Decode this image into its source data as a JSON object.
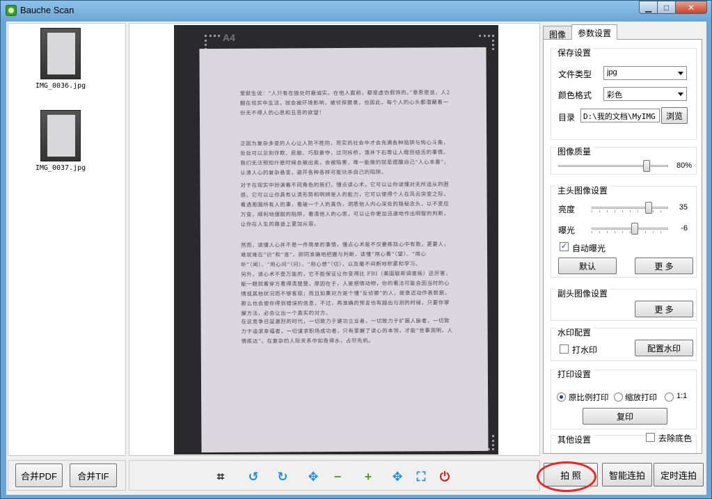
{
  "window": {
    "title": "Bauche Scan",
    "controls": {
      "minimize": "▁",
      "maximize": "□",
      "close": "✕"
    }
  },
  "thumbnails": [
    {
      "name": "IMG_0036.jpg"
    },
    {
      "name": "IMG_0037.jpg"
    }
  ],
  "preview": {
    "paper_size": "A4",
    "paragraphs": [
      "爱默生说：“人只有在独处时最诚实。在他人面前，都是虚伪假饰的。”意思是说，人2 翻在现实中生活，就会被环境影响，被侦探摄录，也因此，每个人的心头都潜藏着一份无不得人的心思和丑恶的欲望！",
      "正因为复杂多变的人心让人防不胜防，现实的社会中才会充满各种陷阱与钩心斗角，处处可以见到诈欺、民脑、巧取豪夺，过河拆桥，落井下石等让人瞠目结舌的事情。我们无法预知什麽时候会被出卖，会被陷害，唯一能做的就是提醒自己“人心本善”，认清人心的复杂悬变，避开各种各样可能坑杀自己的陷阱。",
      "对于在现实中扮演着不同角色的我们，懂点读心术，它可以让你读懂对无所适从的困惑，它可以让你具有认清形势和明辨是人的能力，它可以使得个人在风云突变之际，看透周围所有人的事，看破一个人的真伪，洞悉他人内心深处的隐秘念头，以不变应万变，顺利地摆脱的陷阱，看清他人的心思，可以让你更加迅速地作出明智的判断，让你在人生的路途上更加从容。",
      "然而，读懂人心并不是一件简单的事情，懂点心术是不仅要练就心中有数，更要人，难就难在“识”和“准”，即同准确地把握与判断，读懂“用心看”（望）、“用心听”（闻）、“用心问”（问）、“用心想”（切），以及毫不间断地积累和学习。",
      "另外，读心术不是万能的，它不能保证让你变得比 FBI（美国联邦调查局）还厉害，能一眼就看穿方看得清楚楚，原因在于，人是感情动物，你的看法可能会因当时的心情或其他状况而不够客观；而且如果对方是个懂“反侦察”的人，故意迟动作表数据，那么也会使你得到错误的信息，不过，再准确的预言也有超出与测的时候，只要你掌握方法，必会让出一个真实的对方。",
      "在这竞争日益激烈的时代，一切致力于建功立业者，一切致力于扩展人脉者，一切致力于追求幸福者，一切谋求职场成功者，只有掌握了读心的本领，才能“世事洞明，人情练达”，在复杂的人际关系中如鱼得水，占尽先机。"
    ]
  },
  "settings": {
    "tabs": [
      {
        "label": "图像"
      },
      {
        "label": "参数设置"
      }
    ],
    "save": {
      "title": "保存设置",
      "file_type_label": "文件类型",
      "file_type_value": "jpg",
      "color_format_label": "颜色格式",
      "color_format_value": "彩色",
      "directory_label": "目录",
      "directory_value": "D:\\我的文档\\MyIMG",
      "browse_label": "浏览"
    },
    "quality": {
      "title": "图像质量",
      "value": "80%",
      "level": 0.8
    },
    "main_camera": {
      "title": "主头图像设置",
      "brightness_label": "亮度",
      "brightness_value": "35",
      "exposure_label": "曝光",
      "exposure_value": "-6",
      "auto_exposure_label": "自动曝光",
      "auto_exposure_checked": true,
      "default_label": "默认",
      "more_label": "更 多"
    },
    "sub_camera": {
      "title": "副头图像设置",
      "more_label": "更 多"
    },
    "watermark": {
      "title": "水印配置",
      "enable_label": "打水印",
      "configure_label": "配置水印"
    },
    "print": {
      "title": "打印设置",
      "option_original": "原比例打印",
      "option_scaled": "缩放打印",
      "option_1to1": "1:1",
      "selected": "原比例打印",
      "copy_label": "复印"
    },
    "other": {
      "title": "其他设置",
      "remove_bg_label": "去除底色"
    }
  },
  "bottom": {
    "merge_pdf": "合并PDF",
    "merge_tif": "合并TIF",
    "capture": "拍 照",
    "smart_continuous": "智能连拍",
    "timed_continuous": "定时连拍",
    "tools": [
      {
        "name": "crop-icon",
        "glyph": "⌗"
      },
      {
        "name": "rotate-left-icon",
        "glyph": "↺"
      },
      {
        "name": "rotate-right-icon",
        "glyph": "↻"
      },
      {
        "name": "move-icon",
        "glyph": "✥"
      },
      {
        "name": "zoom-out-icon",
        "glyph": "−"
      },
      {
        "name": "zoom-in-icon",
        "glyph": "+"
      },
      {
        "name": "fit-icon",
        "glyph": "✥"
      },
      {
        "name": "frame-icon",
        "glyph": "⛶"
      },
      {
        "name": "power-icon",
        "glyph": "⏻"
      }
    ],
    "highlight_color": "#e8272b"
  }
}
